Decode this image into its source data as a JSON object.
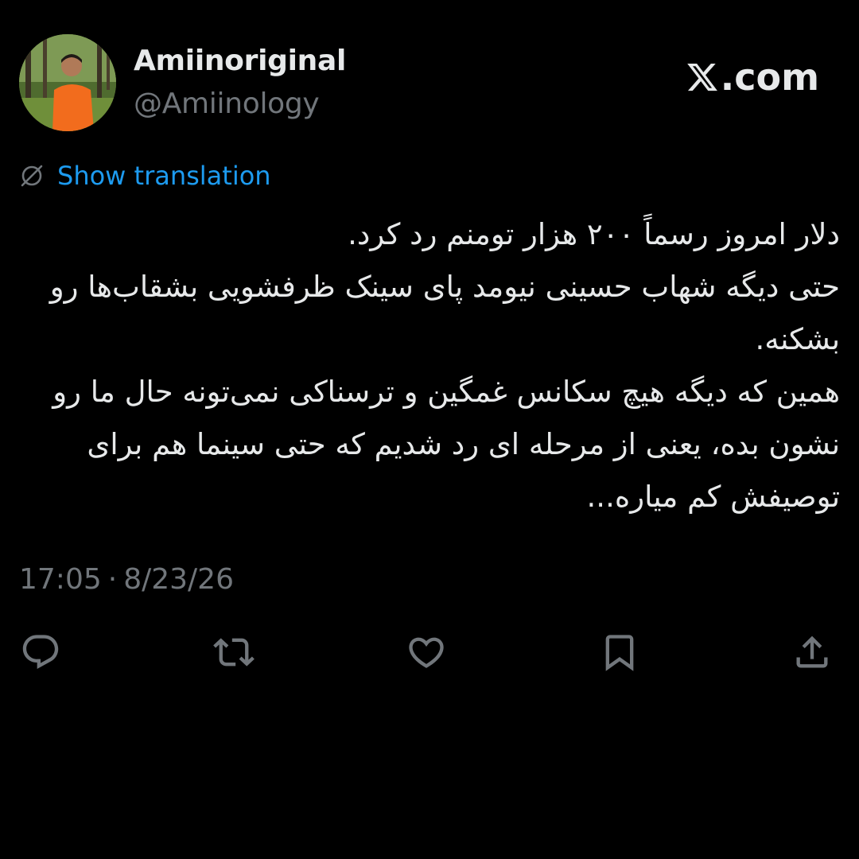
{
  "user": {
    "display_name": "Amiinoriginal",
    "handle": "@Amiinology",
    "avatar_icon": "profile-photo"
  },
  "brand": {
    "label": ".com",
    "logo_icon": "x-logo-icon"
  },
  "translation": {
    "label": "Show translation",
    "icon": "translate-globe-icon"
  },
  "tweet": {
    "lines": [
      "دلار امروز رسماً ۲۰۰ هزار تومنم رد کرد.",
      "حتی دیگه شهاب حسینی نیومد پای سینک ظرفشویی بشقاب‌ها رو بشکنه.",
      "همین که دیگه هیچ سکانس غمگین و ترسناکی نمی‌تونه حال ما رو نشون بده، یعنی از مرحله ای رد شدیم که حتی سینما هم برای توصیفش کم میاره..."
    ]
  },
  "meta": {
    "time": "17:05",
    "separator": "·",
    "date": "8/23/26"
  },
  "actions": [
    {
      "name": "reply",
      "icon": "reply-icon"
    },
    {
      "name": "repost",
      "icon": "repost-icon"
    },
    {
      "name": "like",
      "icon": "heart-icon"
    },
    {
      "name": "bookmark",
      "icon": "bookmark-icon"
    },
    {
      "name": "share",
      "icon": "share-icon"
    }
  ],
  "colors": {
    "background": "#000000",
    "text": "#e7e9ea",
    "muted": "#71767b",
    "link": "#1d9bf0"
  }
}
